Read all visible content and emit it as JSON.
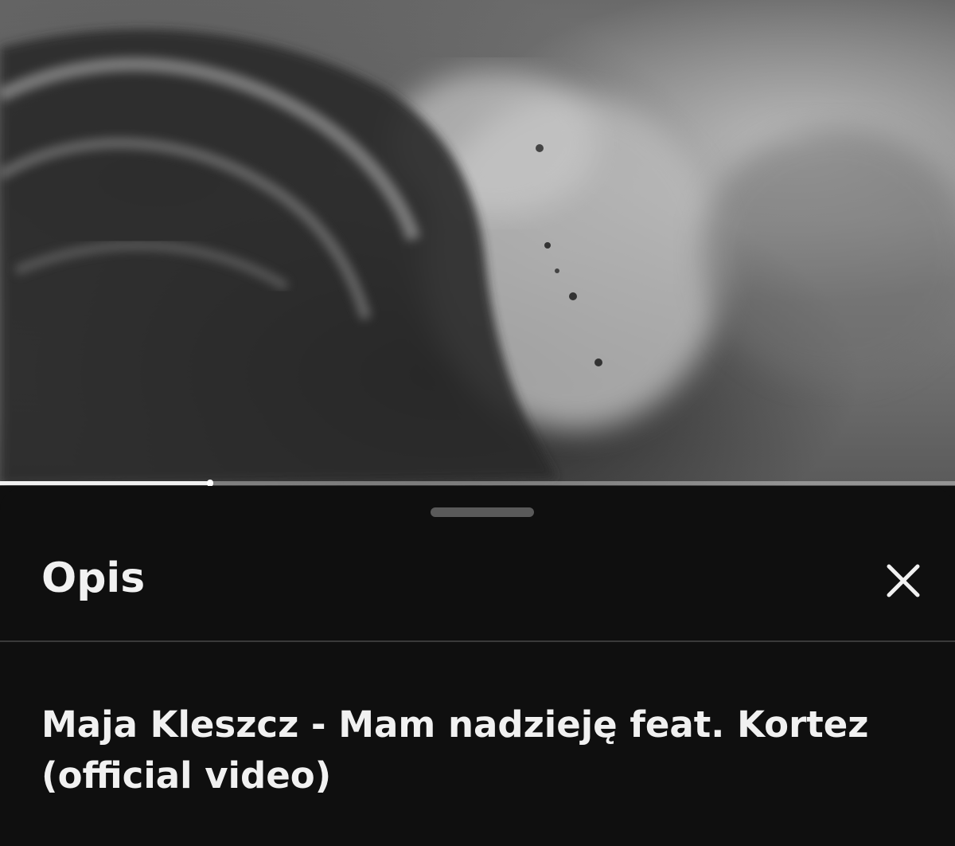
{
  "player": {
    "progress_fraction": 0.22
  },
  "description_panel": {
    "title": "Opis",
    "close_icon": "close-icon",
    "video_title": "Maja Kleszcz - Mam nadzieję feat. Kortez (official video)"
  },
  "colors": {
    "background": "#0f0f0f",
    "text": "#f1f1f1",
    "divider": "#3a3a3a",
    "handle": "#5a5a5a"
  }
}
